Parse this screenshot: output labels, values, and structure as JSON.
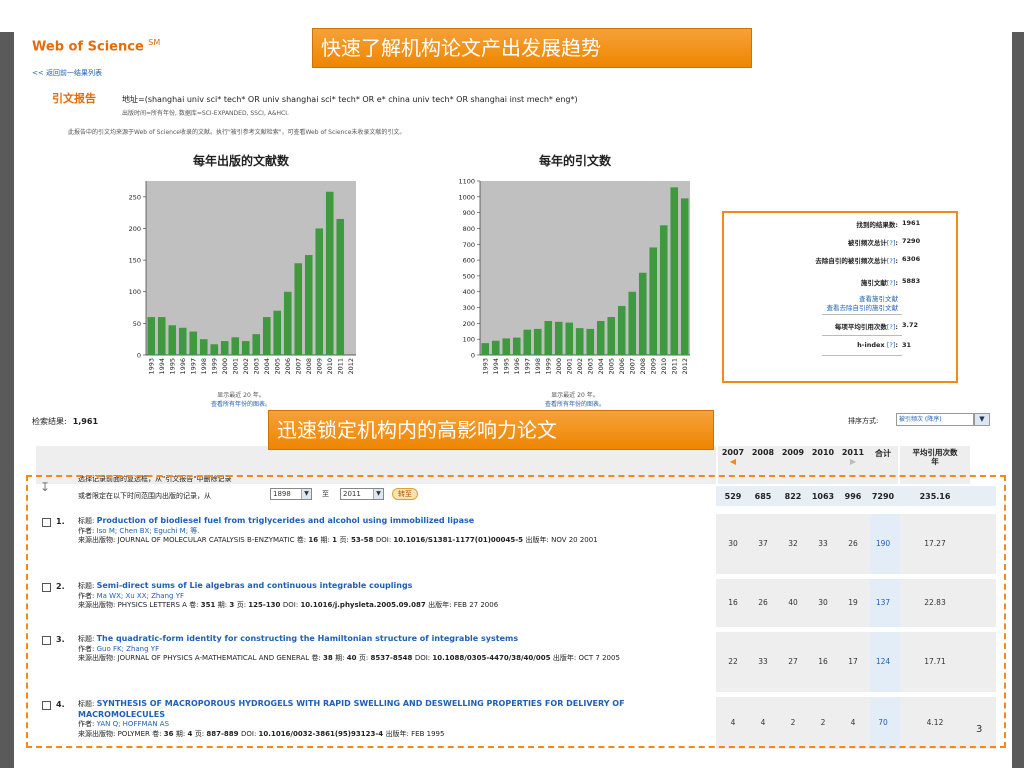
{
  "brand": {
    "name": "Web of Science",
    "mark": "SM"
  },
  "back_link": "<< 返回前一结果列表",
  "report": {
    "title": "引文报告",
    "query": "地址=(shanghai univ sci* tech* OR univ shanghai sci* tech* OR e* china univ tech* OR shanghai inst mech* eng*)",
    "subline": "出版时间=所有年份, 数据库=SCI-EXPANDED, SSCI, A&HCI.",
    "note": "此报告中的引文均来源于Web of Science收录的文献。执行\"被引参考文献检索\"，可查看Web of Science未收录文献的引文。"
  },
  "callouts": {
    "top": "快速了解机构论文产出发展趋势",
    "middle": "迅速锁定机构内的高影响力论文"
  },
  "chart_data": [
    {
      "type": "bar",
      "title": "每年出版的文献数",
      "categories": [
        "1993",
        "1994",
        "1995",
        "1996",
        "1997",
        "1998",
        "1999",
        "2000",
        "2001",
        "2002",
        "2003",
        "2004",
        "2005",
        "2006",
        "2007",
        "2008",
        "2009",
        "2010",
        "2011",
        "2012"
      ],
      "values": [
        60,
        60,
        47,
        43,
        37,
        25,
        17,
        22,
        28,
        22,
        33,
        60,
        70,
        100,
        145,
        158,
        200,
        258,
        215,
        0
      ],
      "ylim": [
        0,
        275
      ],
      "yticks": [
        0,
        50,
        100,
        150,
        200,
        250
      ],
      "footer": "显示最近 20 年。",
      "footer_link": "查看所有年份的图表。",
      "bar_color": "#3f9a3f",
      "bg_color": "#c0c0c0"
    },
    {
      "type": "bar",
      "title": "每年的引文数",
      "categories": [
        "1993",
        "1994",
        "1995",
        "1996",
        "1997",
        "1998",
        "1999",
        "2000",
        "2001",
        "2002",
        "2003",
        "2004",
        "2005",
        "2006",
        "2007",
        "2008",
        "2009",
        "2010",
        "2011",
        "2012"
      ],
      "values": [
        75,
        90,
        105,
        110,
        160,
        165,
        215,
        210,
        205,
        170,
        165,
        215,
        240,
        310,
        400,
        520,
        680,
        820,
        1060,
        990
      ],
      "ylim": [
        0,
        1100
      ],
      "yticks": [
        0,
        100,
        200,
        300,
        400,
        500,
        600,
        700,
        800,
        900,
        1000,
        1100
      ],
      "footer": "显示最近 20 年。",
      "footer_link": "查看所有年份的图表。",
      "bar_color": "#3f9a3f",
      "bg_color": "#c0c0c0"
    }
  ],
  "stats": {
    "results_found_label": "找到的结果数:",
    "results_found": "1961",
    "times_cited_label": "被引频次总计",
    "times_cited": "7290",
    "without_self_label": "去除自引的被引频次总计",
    "without_self": "6306",
    "citing_articles_label": "施引文献",
    "citing_articles": "5883",
    "link1": "查看施引文献",
    "link2": "查看去除自引的施引文献",
    "avg_label": "每项平均引用次数",
    "avg": "3.72",
    "hindex_label": "h-index",
    "hindex": "31",
    "help": "[?]"
  },
  "results": {
    "label": "检索结果:",
    "count": "1,961"
  },
  "sort": {
    "label": "排序方式:",
    "value": "被引频次 (降序)"
  },
  "table": {
    "years": [
      "2007",
      "2008",
      "2009",
      "2010",
      "2011"
    ],
    "total_label": "合计",
    "avg_label": "平均引用次数",
    "avg_label2": "年",
    "select_hint": "选择记录前面的复选框，从\"引文报告\"中删除记录",
    "range_prefix": "或者限定在以下时间范围内出版的记录，从",
    "range_from": "1898",
    "range_to_label": "至",
    "range_to": "2011",
    "go": "转至",
    "sums": [
      "529",
      "685",
      "822",
      "1063",
      "996",
      "7290",
      "235.16"
    ]
  },
  "records": [
    {
      "idx": "1.",
      "title_label": "标题:",
      "title": "Production of biodiesel fuel from triglycerides and alcohol using immobilized lipase",
      "authors_label": "作者:",
      "authors": "Iso M; Chen BX; Eguchi M; 等.",
      "source_label": "来源出版物:",
      "source": "JOURNAL OF MOLECULAR CATALYSIS B-ENZYMATIC",
      "vol": "16",
      "issue": "1",
      "pages": "53-58",
      "doi": "10.1016/S1381-1177(01)00045-5",
      "date": "NOV 20 2001",
      "cites": [
        "30",
        "37",
        "32",
        "33",
        "26",
        "190",
        "17.27"
      ]
    },
    {
      "idx": "2.",
      "title_label": "标题:",
      "title": "Semi-direct sums of Lie algebras and continuous integrable couplings",
      "authors_label": "作者:",
      "authors": "Ma WX; Xu XX; Zhang YF",
      "source_label": "来源出版物:",
      "source": "PHYSICS LETTERS A",
      "vol": "351",
      "issue": "3",
      "pages": "125-130",
      "doi": "10.1016/j.physleta.2005.09.087",
      "date": "FEB 27 2006",
      "cites": [
        "16",
        "26",
        "40",
        "30",
        "19",
        "137",
        "22.83"
      ]
    },
    {
      "idx": "3.",
      "title_label": "标题:",
      "title": "The quadratic-form identity for constructing the Hamiltonian structure of integrable systems",
      "authors_label": "作者:",
      "authors": "Guo FK; Zhang YF",
      "source_label": "来源出版物:",
      "source": "JOURNAL OF PHYSICS A-MATHEMATICAL AND GENERAL",
      "vol": "38",
      "issue": "40",
      "pages": "8537-8548",
      "doi": "10.1088/0305-4470/38/40/005",
      "date": "OCT 7 2005",
      "cites": [
        "22",
        "33",
        "27",
        "16",
        "17",
        "124",
        "17.71"
      ]
    },
    {
      "idx": "4.",
      "title_label": "标题:",
      "title": "SYNTHESIS OF MACROPOROUS HYDROGELS WITH RAPID SWELLING AND DESWELLING PROPERTIES FOR DELIVERY OF MACROMOLECULES",
      "authors_label": "作者:",
      "authors": "YAN Q; HOFFMAN AS",
      "source_label": "来源出版物:",
      "source": "POLYMER",
      "vol": "36",
      "issue": "4",
      "pages": "887-889",
      "doi": "10.1016/0032-3861(95)93123-4",
      "date": "FEB 1995",
      "cites": [
        "4",
        "4",
        "2",
        "2",
        "4",
        "70",
        "4.12"
      ]
    }
  ],
  "labels": {
    "vol": "卷:",
    "issue": "期:",
    "pages": "页:",
    "doi": "DOI:",
    "date": "出版年:"
  },
  "page_number": "3"
}
